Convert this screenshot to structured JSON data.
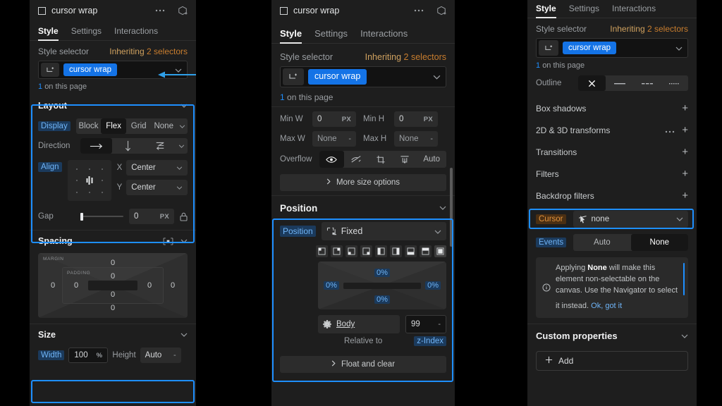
{
  "app": {
    "accent_blue": "#1473e6",
    "highlight_blue": "#1e8fff",
    "amber": "#c87d2e",
    "panel_bg": "#1e1e1e",
    "page_bg": "#000000"
  },
  "panel1": {
    "element_name": "cursor wrap",
    "tabs": [
      {
        "label": "Style",
        "active": true
      },
      {
        "label": "Settings",
        "active": false
      },
      {
        "label": "Interactions",
        "active": false
      }
    ],
    "style_selector": {
      "label": "Style selector",
      "inheriting_text": "Inheriting",
      "inheriting_count": "2 selectors",
      "chip": "cursor wrap",
      "on_this_page_count": "1",
      "on_this_page_text": "on this page"
    },
    "layout": {
      "title": "Layout",
      "display": {
        "label": "Display",
        "options": [
          "Block",
          "Flex",
          "Grid",
          "None"
        ],
        "selected": "Flex"
      },
      "direction": {
        "label": "Direction",
        "options": [
          "row",
          "column",
          "wrap"
        ],
        "selected": "row"
      },
      "align": {
        "label": "Align",
        "x_label": "X",
        "x_value": "Center",
        "y_label": "Y",
        "y_value": "Center"
      },
      "gap": {
        "label": "Gap",
        "value": "0",
        "unit": "PX"
      }
    },
    "spacing": {
      "title": "Spacing",
      "margin_label": "MARGIN",
      "padding_label": "PADDING",
      "margin": {
        "top": "0",
        "right": "0",
        "bottom": "0",
        "left": "0"
      },
      "padding": {
        "top": "0",
        "right": "0",
        "bottom": "0",
        "left": "0"
      }
    },
    "size": {
      "title": "Size",
      "width_label": "Width",
      "width_value": "100",
      "width_unit": "%",
      "height_label": "Height",
      "height_value": "Auto"
    }
  },
  "panel2": {
    "element_name": "cursor wrap",
    "tabs": [
      {
        "label": "Style",
        "active": true
      },
      {
        "label": "Settings",
        "active": false
      },
      {
        "label": "Interactions",
        "active": false
      }
    ],
    "style_selector": {
      "label": "Style selector",
      "inheriting_text": "Inheriting",
      "inheriting_count": "2 selectors",
      "chip": "cursor wrap",
      "on_this_page_count": "1",
      "on_this_page_text": "on this page"
    },
    "size": {
      "min_w_label": "Min W",
      "min_w_value": "0",
      "min_w_unit": "PX",
      "min_h_label": "Min H",
      "min_h_value": "0",
      "min_h_unit": "PX",
      "max_w_label": "Max W",
      "max_w_value": "None",
      "max_h_label": "Max H",
      "max_h_value": "None",
      "overflow_label": "Overflow",
      "overflow_options": [
        "visible",
        "hidden",
        "scroll",
        "clip",
        "Auto"
      ],
      "overflow_selected": "visible",
      "overflow_auto_label": "Auto",
      "more_size_options": "More size options"
    },
    "position": {
      "title": "Position",
      "label": "Position",
      "value": "Fixed",
      "offsets": {
        "top": "0%",
        "right": "0%",
        "bottom": "0%",
        "left": "0%"
      },
      "relative_to_label": "Relative to",
      "relative_to_value": "Body",
      "z_index_label": "z-Index",
      "z_index_value": "99"
    },
    "float_and_clear": "Float and clear"
  },
  "panel3": {
    "tabs": [
      {
        "label": "Style",
        "active": true
      },
      {
        "label": "Settings",
        "active": false
      },
      {
        "label": "Interactions",
        "active": false
      }
    ],
    "style_selector": {
      "label": "Style selector",
      "inheriting_text": "Inheriting",
      "inheriting_count": "2 selectors",
      "chip": "cursor wrap",
      "on_this_page_count": "1",
      "on_this_page_text": "on this page"
    },
    "outline": {
      "label": "Outline",
      "options": [
        "none",
        "solid",
        "dashed",
        "dotted"
      ],
      "selected": "none"
    },
    "effect_rows": [
      {
        "label": "Box shadows",
        "has_dots": false
      },
      {
        "label": "2D & 3D transforms",
        "has_dots": true
      },
      {
        "label": "Transitions",
        "has_dots": false
      },
      {
        "label": "Filters",
        "has_dots": false
      },
      {
        "label": "Backdrop filters",
        "has_dots": false
      }
    ],
    "cursor": {
      "label": "Cursor",
      "value": "none"
    },
    "events": {
      "label": "Events",
      "options": [
        "Auto",
        "None"
      ],
      "selected": "None",
      "info_prefix": "Applying ",
      "info_bold": "None",
      "info_suffix": " will make this element non-selectable on the canvas. Use the Navigator to select it instead.",
      "ok_link": "Ok, got it"
    },
    "custom_properties": {
      "title": "Custom properties",
      "add_label": "Add"
    }
  }
}
